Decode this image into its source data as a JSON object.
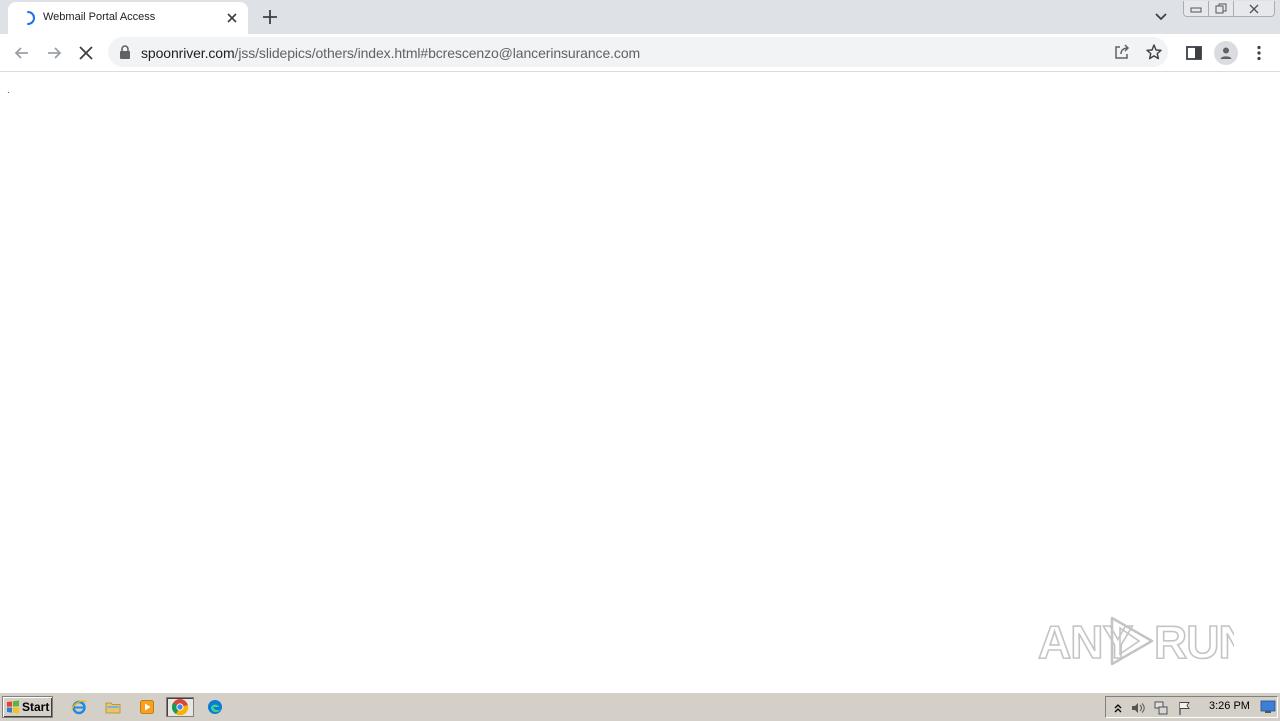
{
  "browser": {
    "tab": {
      "title": "Webmail Portal Access",
      "favicon": "loading-spinner-icon"
    },
    "url": {
      "host": "spoonriver.com",
      "path": "/jss/slidepics/others/index.html#bcrescenzo@lancerinsurance.com"
    }
  },
  "content": {
    "text": "."
  },
  "watermark": {
    "text": "ANY RUN"
  },
  "taskbar": {
    "start_label": "Start",
    "clock": "3:26 PM"
  },
  "colors": {
    "tabstrip": "#dee1e6",
    "omnibox": "#f1f3f4",
    "taskbar": "#d4d0c8",
    "accent": "#1a73e8"
  }
}
